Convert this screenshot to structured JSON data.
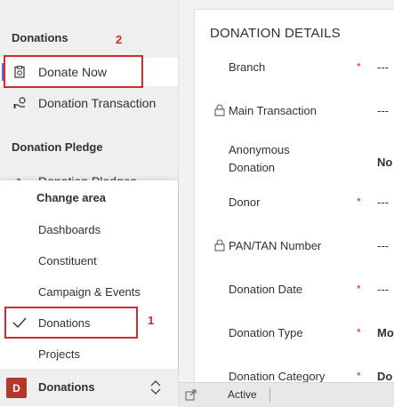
{
  "sidebar": {
    "section1_title": "Donations",
    "items1": [
      {
        "label": "Donate Now",
        "icon": "donate-now-icon",
        "selected": true
      },
      {
        "label": "Donation Transaction",
        "icon": "hand-coin-icon"
      }
    ],
    "section2_title": "Donation Pledge",
    "items2": [
      {
        "label": "Donation Pledges",
        "icon": "pledge-icon"
      }
    ]
  },
  "annotations": {
    "marker_2": "2",
    "marker_1": "1",
    "color": "#d42a2a"
  },
  "flyout": {
    "header": "Change area",
    "items": [
      {
        "label": "Dashboards"
      },
      {
        "label": "Constituent"
      },
      {
        "label": "Campaign & Events"
      },
      {
        "label": "Donations",
        "checked": true
      },
      {
        "label": "Projects"
      }
    ]
  },
  "area_switcher": {
    "badge": "D",
    "label": "Donations",
    "badge_color": "#b4372e"
  },
  "form": {
    "title": "DONATION DETAILS",
    "fields": [
      {
        "label": "Branch",
        "required": "*",
        "value": "---",
        "locked": false
      },
      {
        "label": "Main Transaction",
        "required": "",
        "value": "---",
        "locked": true
      },
      {
        "label": "Anonymous Donation",
        "required": "",
        "value": "No",
        "locked": false
      },
      {
        "label": "Donor",
        "required": "*",
        "value": "---",
        "locked": false
      },
      {
        "label": "PAN/TAN Number",
        "required": "",
        "value": "---",
        "locked": true
      },
      {
        "label": "Donation Date",
        "required": "*",
        "value": "---",
        "locked": false
      },
      {
        "label": "Donation Type",
        "required": "*",
        "value": "Mo",
        "locked": false
      },
      {
        "label": "Donation Category",
        "required": "*",
        "value": "Do",
        "locked": false
      }
    ]
  },
  "statusbar": {
    "status": "Active",
    "icon": "open-in-new-window-icon"
  }
}
